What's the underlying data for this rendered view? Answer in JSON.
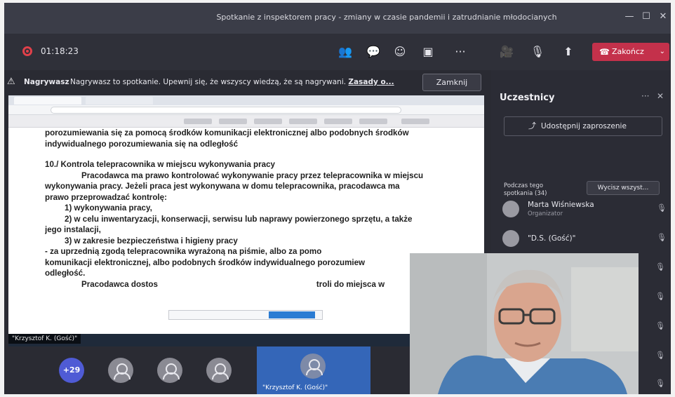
{
  "window": {
    "title": "Spotkanie z inspektorem pracy - zmiany w czasie pandemii i zatrudnianie młodocianych",
    "minimize_glyph": "—",
    "maximize_glyph": "☐",
    "close_glyph": "✕"
  },
  "toolbar": {
    "timer": "01:18:23",
    "participants_glyph": "👥",
    "chat_glyph": "💬",
    "reactions_glyph": "☺",
    "rooms_glyph": "▣",
    "more_glyph": "···",
    "camera_glyph": "🎥",
    "mic_glyph": "🎙",
    "share_glyph": "⬆",
    "end_label": "Zakończ",
    "end_phone_glyph": "☎",
    "end_chevron_glyph": "⌄"
  },
  "recording_banner": {
    "warning_glyph": "⚠",
    "label": "Nagrywasz",
    "message": "Nagrywasz to spotkanie. Upewnij się, że wszyscy wiedzą, że są nagrywani.",
    "link": "Zasady o...",
    "close_label": "Zamknij"
  },
  "document": {
    "lines": [
      "porozumiewania się za pomocą środków komunikacji elektronicznej albo podobnych środków",
      "indywidualnego porozumiewania się na odległość"
    ],
    "heading": "10./ Kontrola telepracownika w miejscu wykonywania pracy",
    "para1": [
      "Pracodawca ma prawo kontrolować wykonywanie pracy przez telepracownika w miejscu",
      "wykonywania pracy. Jeżeli praca jest wykonywana w domu telepracownika, pracodawca ma",
      "prawo przeprowadzać kontrolę:"
    ],
    "list": [
      "1) wykonywania pracy,",
      "2) w celu inwentaryzacji, konserwacji, serwisu lub naprawy powierzonego sprzętu, a także",
      "jego instalacji,",
      "3) w zakresie bezpieczeństwa i higieny pracy"
    ],
    "para2": [
      "- za uprzednią zgodą telepracownika wyrażoną na piśmie, albo za pomo",
      "komunikacji elektronicznej, albo podobnych środków indywidualnego porozumiew",
      "odległość."
    ],
    "para3_start": "Pracodawca dostos",
    "para3_end": "troli do miejsca w"
  },
  "shared_screen_presenter": "\"Krzysztof K. (Gość)\"",
  "bottom_tiles": {
    "more_count": "+29",
    "guest_name": "\"Krzysztof K. (Gość)\""
  },
  "panel": {
    "title": "Uczestnicy",
    "more_glyph": "···",
    "close_glyph": "✕",
    "share_invite_glyph": "⤴",
    "share_invite": "Udostępnij zaproszenie",
    "section_label": "Podczas tego spotkania (34)",
    "mute_all": "Wycisz wszyst...",
    "participants": [
      {
        "name": "Marta Wiśniewska",
        "role": "Organizator"
      },
      {
        "name": "\"D.S. (Gość)\"",
        "role": ""
      }
    ],
    "mic_off_glyph": "🎙"
  }
}
